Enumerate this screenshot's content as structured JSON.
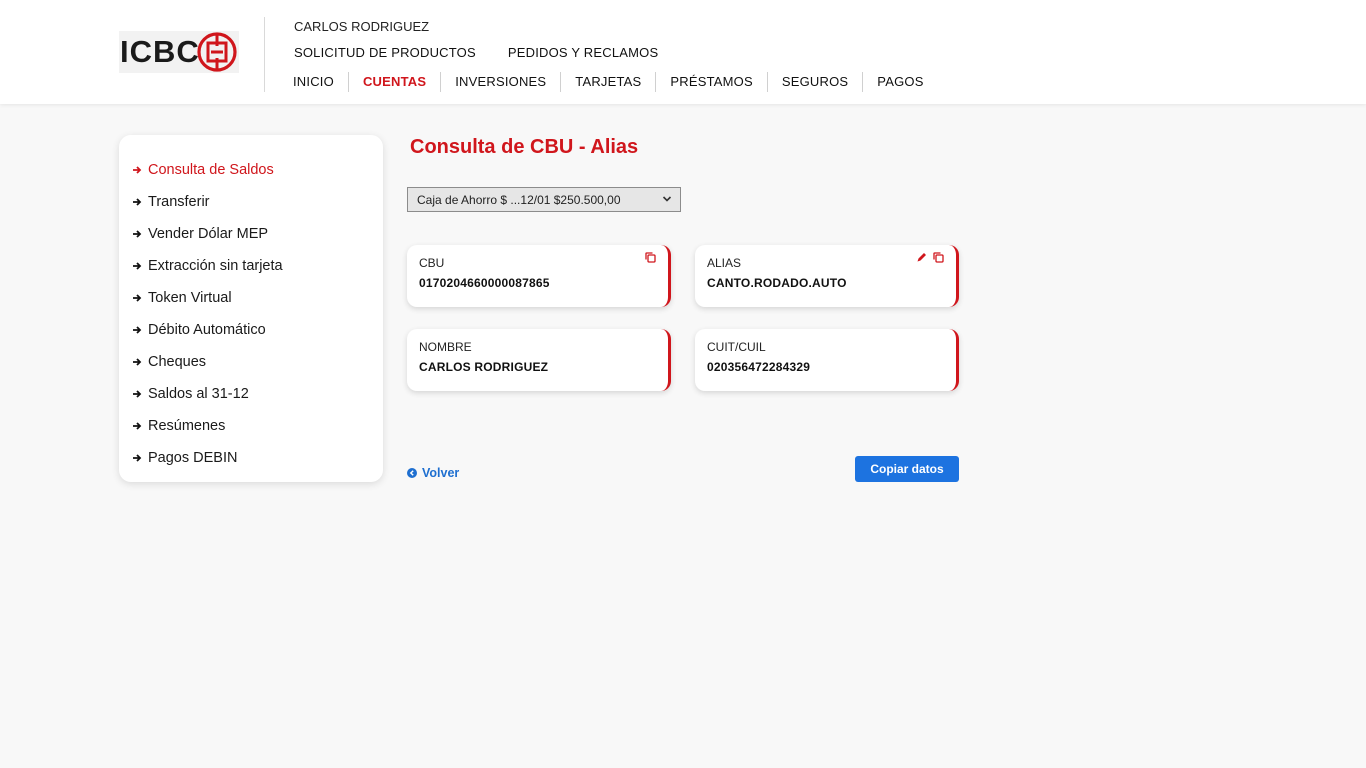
{
  "header": {
    "logo_text": "ICBC",
    "user_name": "CARLOS RODRIGUEZ",
    "top_links": [
      "SOLICITUD DE PRODUCTOS",
      "PEDIDOS Y RECLAMOS"
    ],
    "nav": [
      "INICIO",
      "CUENTAS",
      "INVERSIONES",
      "TARJETAS",
      "PRÉSTAMOS",
      "SEGUROS",
      "PAGOS"
    ],
    "active_nav": "CUENTAS"
  },
  "sidebar": {
    "items": [
      {
        "label": "Consulta de Saldos",
        "active": true
      },
      {
        "label": "Transferir"
      },
      {
        "label": "Vender Dólar MEP"
      },
      {
        "label": "Extracción sin tarjeta"
      },
      {
        "label": "Token Virtual"
      },
      {
        "label": "Débito Automático"
      },
      {
        "label": "Cheques"
      },
      {
        "label": "Saldos al 31-12"
      },
      {
        "label": "Resúmenes"
      },
      {
        "label": "Pagos DEBIN"
      }
    ]
  },
  "main": {
    "title": "Consulta de CBU - Alias",
    "account_select": "Caja de Ahorro $ ...12/01 $250.500,00",
    "cards": {
      "cbu": {
        "label": "CBU",
        "value": "0170204660000087865"
      },
      "alias": {
        "label": "ALIAS",
        "value": "CANTO.RODADO.AUTO"
      },
      "nombre": {
        "label": "NOMBRE",
        "value": "CARLOS RODRIGUEZ"
      },
      "cuit": {
        "label": "CUIT/CUIL",
        "value": "020356472284329"
      }
    },
    "back_label": "Volver",
    "copy_button": "Copiar datos"
  },
  "icons": {
    "copy": "copy-icon",
    "edit": "pencil-icon",
    "back": "arrow-left-circle-icon",
    "chevron": "chevron-down-icon",
    "menu_arrow": "arrow-right-icon"
  },
  "colors": {
    "brand_red": "#d0161c",
    "link_blue": "#1e6fd0",
    "button_blue": "#1d73e0"
  }
}
